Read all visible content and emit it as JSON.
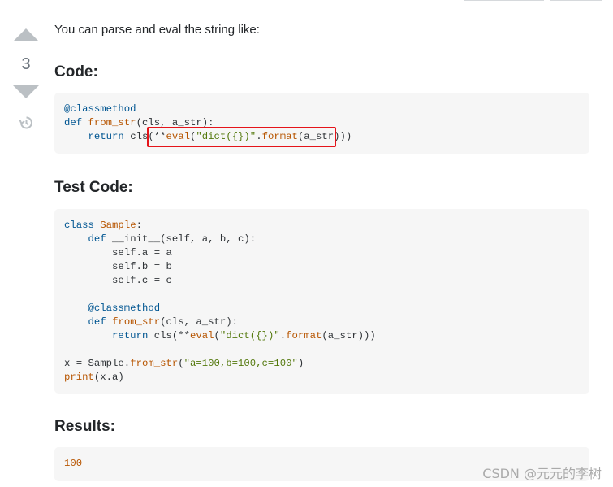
{
  "vote": {
    "count": "3"
  },
  "answer": {
    "intro": "You can parse and eval the string like:",
    "heading_code": "Code:",
    "heading_test": "Test Code:",
    "heading_results": "Results:"
  },
  "code_block_1": [
    "@classmethod",
    "def from_str(cls, a_str):",
    "    return cls(**eval(\"dict({})\".format(a_str)))"
  ],
  "code_block_2": [
    "class Sample:",
    "    def __init__(self, a, b, c):",
    "        self.a = a",
    "        self.b = b",
    "        self.c = c",
    "",
    "    @classmethod",
    "    def from_str(cls, a_str):",
    "        return cls(**eval(\"dict({})\".format(a_str)))",
    "",
    "x = Sample.from_str(\"a=100,b=100,c=100\")",
    "print(x.a)"
  ],
  "results_block": "100",
  "watermark": "CSDN @元元的李树",
  "colors": {
    "highlight": "#e5141a",
    "code_bg": "#f6f6f6",
    "arrow": "#bbc0c4"
  },
  "icons": {
    "upvote": "arrow-up-icon",
    "downvote": "arrow-down-icon",
    "history": "history-icon"
  }
}
